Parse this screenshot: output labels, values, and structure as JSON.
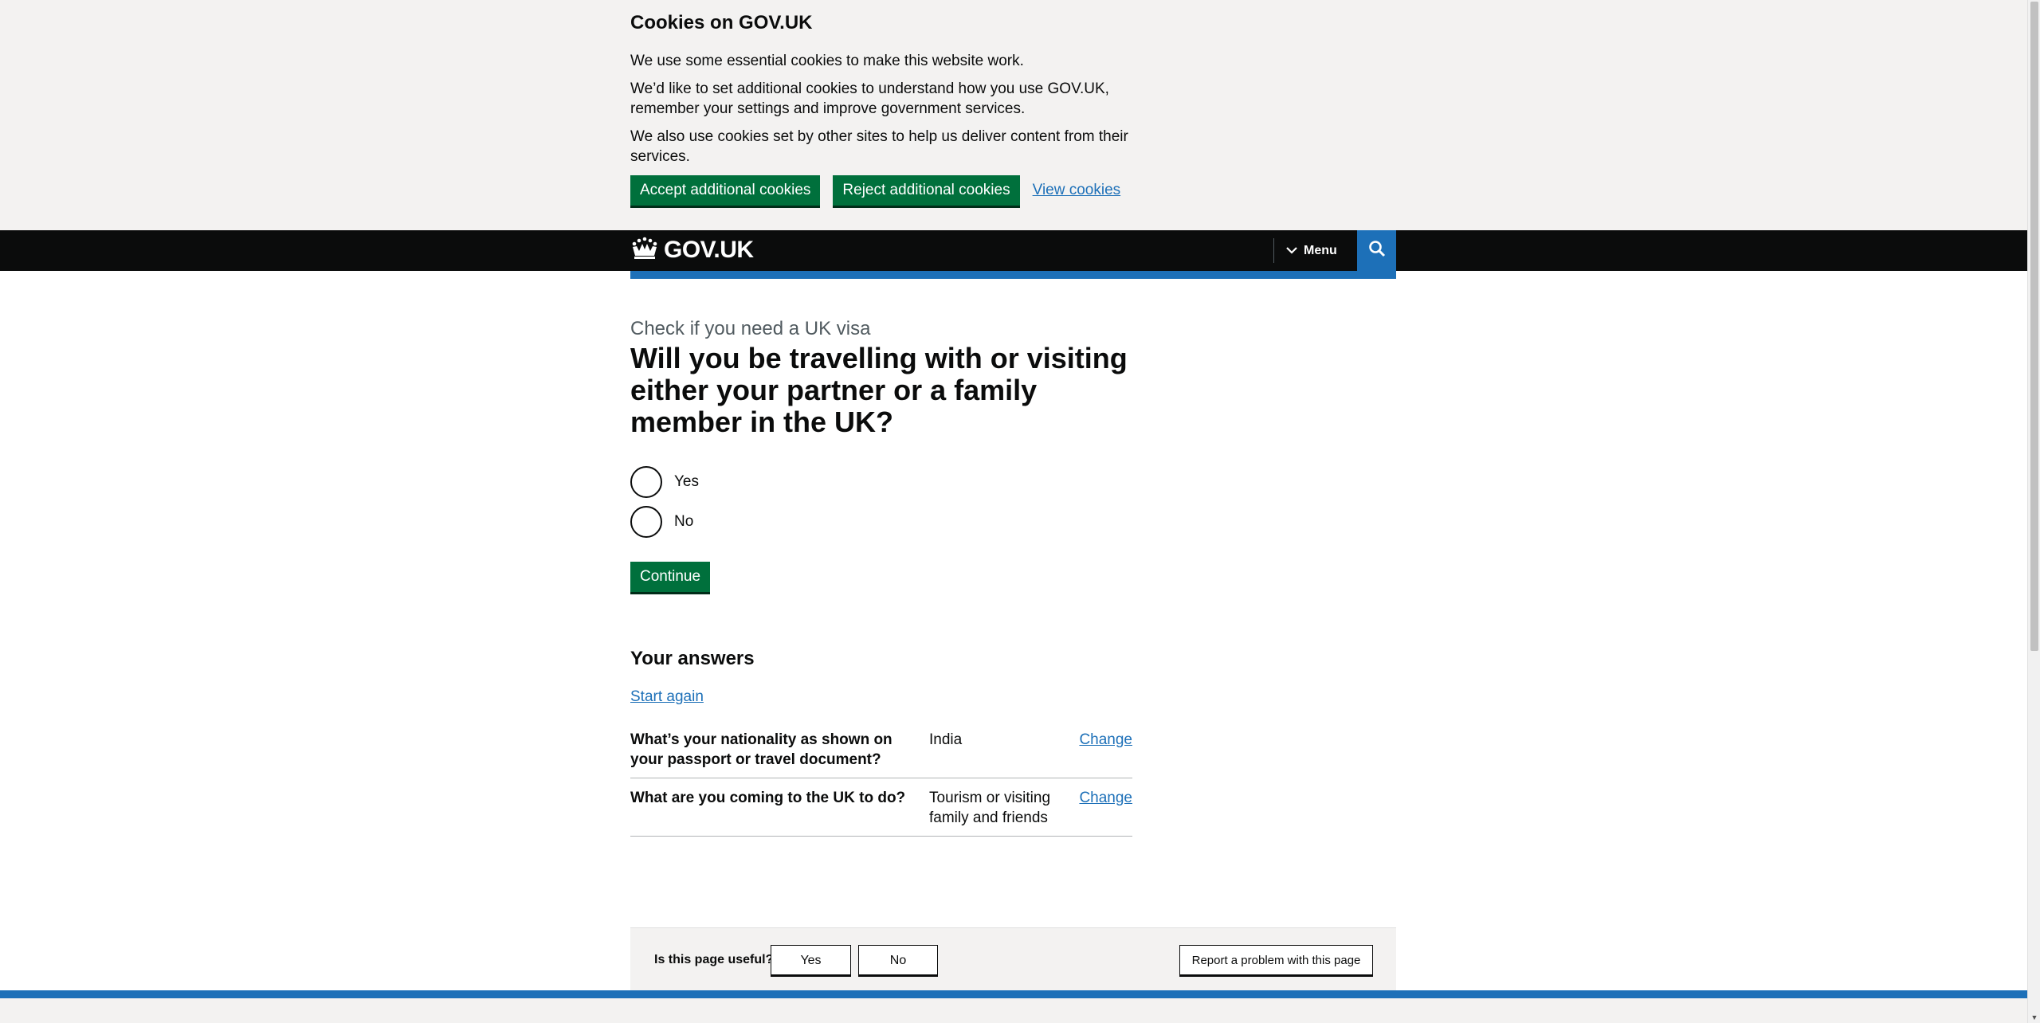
{
  "cookie_banner": {
    "title": "Cookies on GOV.UK",
    "paragraphs": [
      "We use some essential cookies to make this website work.",
      "We’d like to set additional cookies to understand how you use GOV.UK, remember your settings and improve government services.",
      "We also use cookies set by other sites to help us deliver content from their services."
    ],
    "accept_label": "Accept additional cookies",
    "reject_label": "Reject additional cookies",
    "view_label": "View cookies"
  },
  "header": {
    "logo_text": "GOV.UK",
    "menu_label": "Menu",
    "icons": {
      "logo": "crown-icon",
      "menu": "chevron-down-icon",
      "search": "search-icon"
    },
    "colors": {
      "header_bg": "#0b0c0c",
      "accent": "#1d70b8"
    }
  },
  "question": {
    "caption": "Check if you need a UK visa",
    "title": "Will you be travelling with or visiting either your partner or a family member in the UK?",
    "options": [
      "Yes",
      "No"
    ],
    "continue_label": "Continue"
  },
  "answers": {
    "title": "Your answers",
    "start_again": "Start again",
    "rows": [
      {
        "question": "What’s your nationality as shown on your passport or travel document?",
        "answer": "India",
        "action": "Change"
      },
      {
        "question": "What are you coming to the UK to do?",
        "answer": "Tourism or visiting family and friends",
        "action": "Change"
      }
    ]
  },
  "feedback": {
    "question": "Is this page useful?",
    "yes_label": "Yes",
    "no_label": "No",
    "report_label": "Report a problem with this page"
  },
  "colors": {
    "button_green": "#00703c",
    "link_blue": "#1d70b8",
    "banner_bg": "#f3f2f1"
  }
}
